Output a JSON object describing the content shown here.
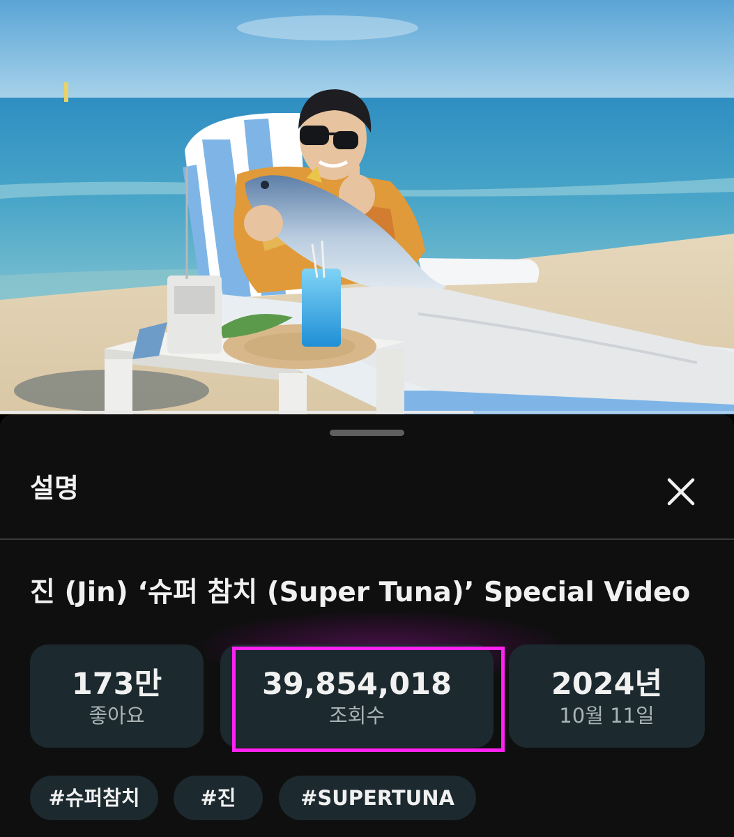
{
  "video": {
    "progress_fraction": 0.645,
    "thumbnail_icon": "beach-scene-image"
  },
  "sheet": {
    "title": "설명",
    "close_icon": "close-icon"
  },
  "description": {
    "video_title": "진 (Jin) ‘슈퍼 참치 (Super Tuna)’ Special Video",
    "stats": [
      {
        "value": "173만",
        "label": "좋아요"
      },
      {
        "value": "39,854,018",
        "label": "조회수"
      },
      {
        "value": "2024년",
        "label": "10월 11일"
      }
    ],
    "hashtags": [
      "#슈퍼참치",
      "#진",
      "#SUPERTUNA"
    ]
  },
  "colors": {
    "sheet_background": "#0f0f0f",
    "chip_background": "#1c292e",
    "highlight": "#ff22f0",
    "text": "#f1f1f1"
  }
}
